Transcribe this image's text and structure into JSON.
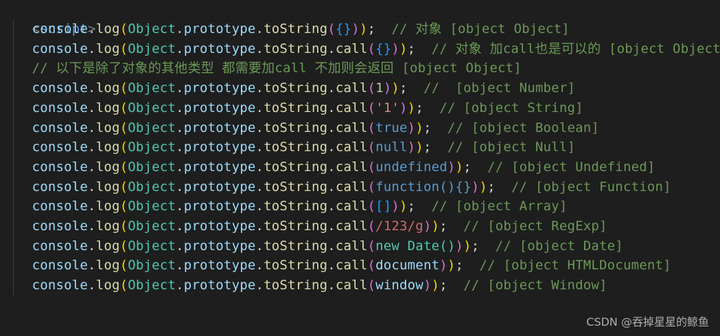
{
  "editor": {
    "language": "javascript",
    "theme": "dark"
  },
  "tag": {
    "open": "<",
    "name": "script",
    "close": ">"
  },
  "lines": [
    {
      "pre": "    ",
      "obj": "console",
      "dot1": ".",
      "fn1": "log",
      "p1": "(",
      "cls": "Object",
      "dot2": ".",
      "prop": "prototype",
      "dot3": ".",
      "fn2": "toString",
      "p2": "(",
      "argA": "{",
      "argB": "}",
      "p3": ")",
      "p4": ")",
      "semi": ";",
      "sp": "  ",
      "comment": "// 对象 [object Object]"
    },
    {
      "pre": "    ",
      "obj": "console",
      "dot1": ".",
      "fn1": "log",
      "p1": "(",
      "cls": "Object",
      "dot2": ".",
      "prop": "prototype",
      "dot3": ".",
      "fn2": "toString",
      "dot4": ".",
      "call": "call",
      "p2": "(",
      "argA": "{",
      "argB": "}",
      "p3": ")",
      "p4": ")",
      "semi": ";",
      "sp": "  ",
      "comment": "// 对象 加call也是可以的 [object Object]"
    },
    {
      "pre": "    ",
      "comment": "// 以下是除了对象的其他类型 都需要加call 不加则会返回 [object Object]"
    },
    {
      "arg": "1",
      "argType": "num",
      "comment": "//  [object Number]"
    },
    {
      "arg": "'1'",
      "argType": "str",
      "comment": "// [object String]"
    },
    {
      "arg": "true",
      "argType": "kw",
      "comment": "// [object Boolean]"
    },
    {
      "arg": "null",
      "argType": "kw",
      "comment": "// [object Null]"
    },
    {
      "arg": "undefined",
      "argType": "kw",
      "comment": "// [object Undefined]"
    },
    {
      "arg": "function(){}",
      "argType": "func",
      "comment": "// [object Function]"
    },
    {
      "arg": "[]",
      "argType": "arr",
      "comment": "// [object Array]"
    },
    {
      "arg": "/123/g",
      "argType": "regex",
      "comment": "// [object RegExp]"
    },
    {
      "arg": "new Date()",
      "argType": "newdate",
      "comment": "// [object Date]"
    },
    {
      "arg": "document",
      "argType": "var",
      "comment": "// [object HTMLDocument]"
    },
    {
      "arg": "window",
      "argType": "var",
      "comment": "// [object Window]"
    }
  ],
  "code_prefix": {
    "indent": "    ",
    "console": "console",
    "dot": ".",
    "log": "log",
    "open": "(",
    "object": "Object",
    "prototype": "prototype",
    "toString": "toString",
    "call": "call",
    "close": ")",
    "semi": ";"
  },
  "watermark": "CSDN @吞掉星星的鲸鱼"
}
